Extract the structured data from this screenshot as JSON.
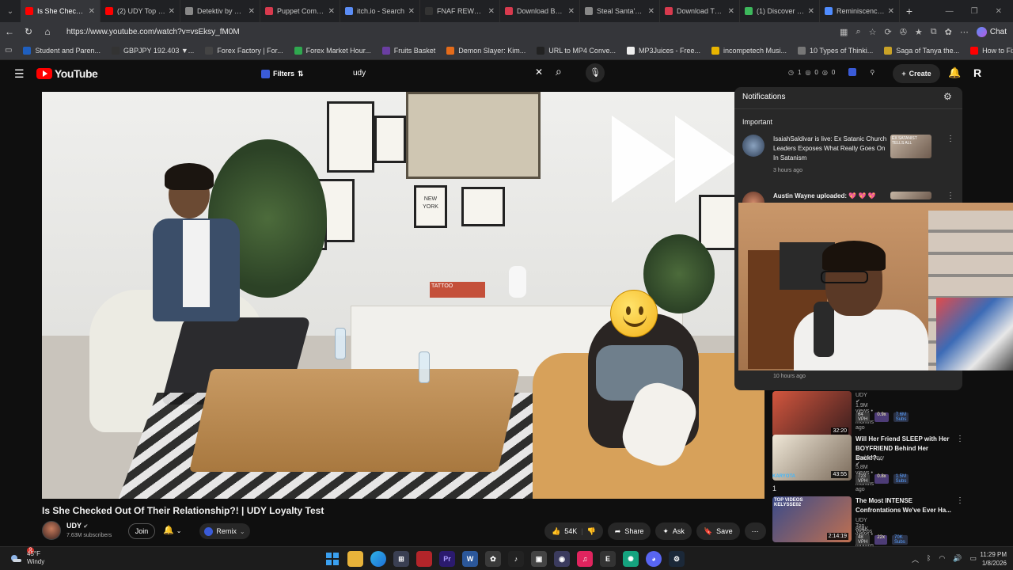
{
  "browser": {
    "tabs": [
      {
        "label": "Is She Checked O",
        "color": "#ff0000",
        "active": true
      },
      {
        "label": "(2) UDY Top Vide",
        "color": "#ff0000"
      },
      {
        "label": "Detektiv by Vuk D",
        "color": "#888888"
      },
      {
        "label": "Puppet Combo - ",
        "color": "#d83a4e"
      },
      {
        "label": "itch.io - Search",
        "color": "#5b8df6"
      },
      {
        "label": "FNAF REWRITTEN",
        "color": "#333333"
      },
      {
        "label": "Download BLOOD",
        "color": "#d83a4e"
      },
      {
        "label": "Steal Santa's Pills",
        "color": "#888888"
      },
      {
        "label": "Download The N",
        "color": "#d83a4e"
      },
      {
        "label": "(1) Discover - Gar",
        "color": "#3db85c"
      },
      {
        "label": "Reminiscence on",
        "color": "#4f8cff"
      }
    ],
    "url": "https://www.youtube.com/watch?v=vsEksy_fM0M",
    "chat_label": "Chat",
    "bookmarks": [
      {
        "label": "Student and Paren...",
        "color": "#1f5fbf"
      },
      {
        "label": "GBPJPY 192.403 ▼...",
        "color": "#333333"
      },
      {
        "label": "Forex Factory | For...",
        "color": "#444444"
      },
      {
        "label": "Forex Market Hour...",
        "color": "#2fa84f"
      },
      {
        "label": "Fruits Basket",
        "color": "#6a3ea1"
      },
      {
        "label": "Demon Slayer: Kim...",
        "color": "#e46b1a"
      },
      {
        "label": "URL to MP4 Conve...",
        "color": "#222222"
      },
      {
        "label": "MP3Juices - Free...",
        "color": "#eeeeee"
      },
      {
        "label": "incompetech Musi...",
        "color": "#e8b400"
      },
      {
        "label": "10 Types of Thinki...",
        "color": "#777777"
      },
      {
        "label": "Saga of Tanya the...",
        "color": "#c9a227"
      },
      {
        "label": "How to Fix Screen...",
        "color": "#ff0000"
      }
    ]
  },
  "youtube": {
    "logo_text": "YouTube",
    "filters_label": "Filters",
    "search_value": "udy",
    "counters": [
      "1",
      "0",
      "0"
    ],
    "create_label": "Create",
    "avatar_letter": "R"
  },
  "video": {
    "title": "Is She Checked Out Of Their Relationship?! | UDY Loyalty Test",
    "channel": "UDY",
    "subscribers": "7.63M subscribers",
    "join_label": "Join",
    "remix_label": "Remix",
    "likes": "54K",
    "share_label": "Share",
    "ask_label": "Ask",
    "save_label": "Save",
    "frame_texts": {
      "book": "TATTOO",
      "print": "NEW YORK"
    }
  },
  "notifications": {
    "title": "Notifications",
    "section": "Important",
    "items": [
      {
        "text": "IsaiahSaldivar is live: Ex Satanic Church Leaders Exposes What Really Goes On In Satanism",
        "time": "3 hours ago",
        "thumb_text": "EX SATANIST TELLS ALL"
      },
      {
        "text": "Austin Wayne uploaded: 💖 💖 💖",
        "time": ""
      },
      {
        "text": "",
        "time": "10 hours ago"
      }
    ]
  },
  "suggested": [
    {
      "title": "",
      "channel": "UDY",
      "meta": "1.9M views • 9 months ago",
      "duration": "32:20",
      "vph": "64 VPH",
      "mult": "0.9x",
      "subs": "7.6M Subs"
    },
    {
      "title": "Will Her Friend SLEEP with Her BOYFRIEND Behind Her Back!?...",
      "channel": "soulessjayy",
      "meta": "5.8M views • 8 months ago",
      "duration": "43:55",
      "vph": "723 VPH",
      "mult": "0.8x",
      "subs": "1.5M Subs",
      "thumb_caption": "KARYOTA",
      "rank": "1"
    },
    {
      "title": "The Most INTENSE Confrontations We've Ever Ha...",
      "channel": "UDY Top Videos",
      "meta": "854K views • 8 months ago",
      "duration": "2:14:19",
      "vph": "48 VPH",
      "mult": "22x",
      "subs": "70K Subs",
      "thumb_caption": "TOP VIDEOS KELYSSE02",
      "rank": "1"
    }
  ],
  "taskbar": {
    "temperature": "45°F",
    "condition": "Windy",
    "weather_badge": "9",
    "time": "11:29 PM",
    "date": "1/8/2026"
  }
}
